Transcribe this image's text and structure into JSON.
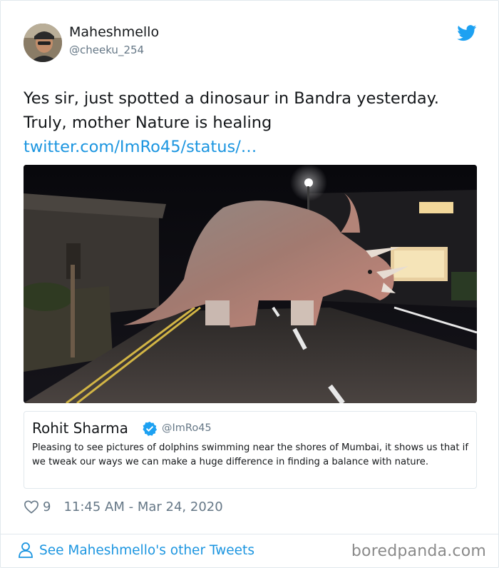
{
  "author": {
    "display_name": "Maheshmello",
    "handle": "@cheeku_254"
  },
  "tweet": {
    "line1": "Yes sir, just spotted a dinosaur in Bandra yesterday.",
    "line2": "Truly, mother Nature is healing",
    "link": "twitter.com/ImRo45/status/…"
  },
  "quoted_tweet": {
    "display_name": "Rohit Sharma",
    "handle": "@ImRo45",
    "text": "Pleasing to see pictures of dolphins swimming near the shores of Mumbai, it shows us that if we tweak our ways we can make a huge difference in finding a balance with nature."
  },
  "meta": {
    "likes": "9",
    "timestamp": "11:45 AM - Mar 24, 2020"
  },
  "footer": {
    "see_more": "See Maheshmello's other Tweets"
  },
  "watermark": "boredpanda.com",
  "icons": {
    "twitter": "twitter-bird-icon",
    "verified": "verified-badge-icon",
    "like": "heart-icon",
    "profile": "person-icon"
  },
  "colors": {
    "link": "#1b95e0",
    "secondary_text": "#657786",
    "border": "#e1e8ed"
  }
}
